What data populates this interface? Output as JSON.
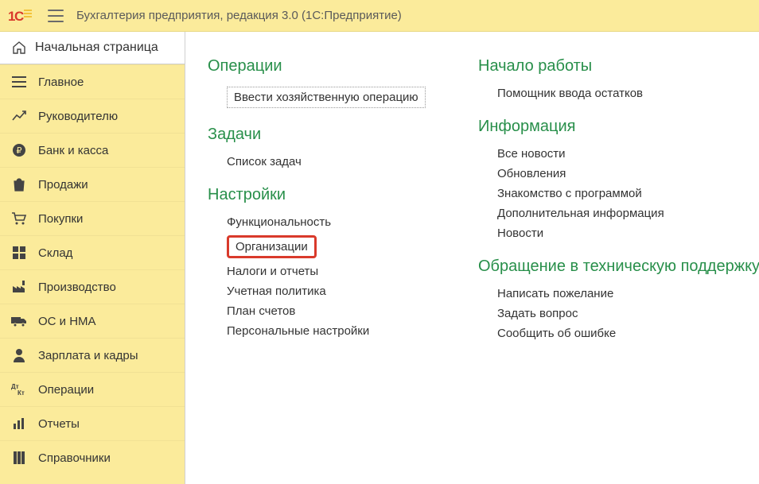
{
  "titlebar": {
    "title": "Бухгалтерия предприятия, редакция 3.0   (1С:Предприятие)"
  },
  "start_tab": {
    "label": "Начальная страница"
  },
  "sidebar": {
    "items": [
      {
        "label": "Главное",
        "icon": "menu-icon"
      },
      {
        "label": "Руководителю",
        "icon": "chart-line-icon"
      },
      {
        "label": "Банк и касса",
        "icon": "ruble-circle-icon"
      },
      {
        "label": "Продажи",
        "icon": "bag-icon"
      },
      {
        "label": "Покупки",
        "icon": "cart-icon"
      },
      {
        "label": "Склад",
        "icon": "grid-icon"
      },
      {
        "label": "Производство",
        "icon": "factory-icon"
      },
      {
        "label": "ОС и НМА",
        "icon": "truck-icon"
      },
      {
        "label": "Зарплата и кадры",
        "icon": "person-icon"
      },
      {
        "label": "Операции",
        "icon": "dt-kt-icon"
      },
      {
        "label": "Отчеты",
        "icon": "bar-chart-icon"
      },
      {
        "label": "Справочники",
        "icon": "books-icon"
      }
    ]
  },
  "content": {
    "left": {
      "section1": {
        "title": "Операции",
        "items": [
          "Ввести хозяйственную операцию"
        ]
      },
      "section2": {
        "title": "Задачи",
        "items": [
          "Список задач"
        ]
      },
      "section3": {
        "title": "Настройки",
        "items": [
          "Функциональность",
          "Организации",
          "Налоги и отчеты",
          "Учетная политика",
          "План счетов",
          "Персональные настройки"
        ]
      }
    },
    "right": {
      "section1": {
        "title": "Начало работы",
        "items": [
          "Помощник ввода остатков"
        ]
      },
      "section2": {
        "title": "Информация",
        "items": [
          "Все новости",
          "Обновления",
          "Знакомство с программой",
          "Дополнительная информация",
          "Новости"
        ]
      },
      "section3": {
        "title": "Обращение в техническую поддержку",
        "items": [
          "Написать пожелание",
          "Задать вопрос",
          "Сообщить об ошибке"
        ]
      }
    }
  }
}
